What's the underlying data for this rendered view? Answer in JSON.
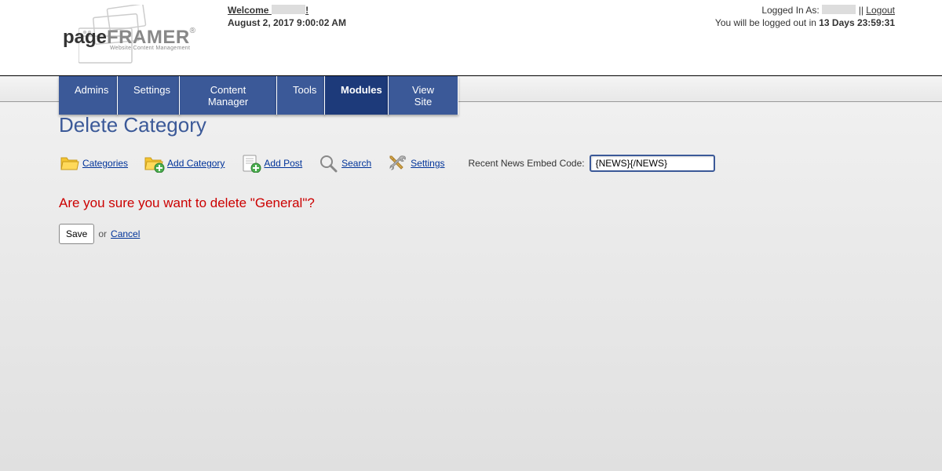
{
  "header": {
    "welcome_prefix": "Welcome ",
    "welcome_suffix": "!",
    "date": "August 2, 2017 9:00:02 AM",
    "logged_in_as_label": "Logged In As: ",
    "logged_in_separator": " || ",
    "logout_label": "Logout",
    "logout_timer_prefix": "You will be logged out in ",
    "logout_timer_value": "13 Days 23:59:31"
  },
  "logo": {
    "page": "page",
    "framer": "FRAMER",
    "reg": "®",
    "sub": "Website Content Management"
  },
  "nav": {
    "admins": "Admins",
    "settings": "Settings",
    "content_manager": "Content Manager",
    "tools": "Tools",
    "modules": "Modules",
    "view_site": "View Site"
  },
  "page_title": "Delete Category",
  "toolbar": {
    "categories": "Categories",
    "add_category": "Add Category",
    "add_post": "Add Post",
    "search": "Search",
    "settings": "Settings",
    "embed_code_label": "Recent News Embed Code:",
    "embed_code_value": "{NEWS}{/NEWS}"
  },
  "confirm_message": "Are you sure you want to delete \"General\"?",
  "actions": {
    "save": "Save",
    "or": "or",
    "cancel": "Cancel"
  }
}
